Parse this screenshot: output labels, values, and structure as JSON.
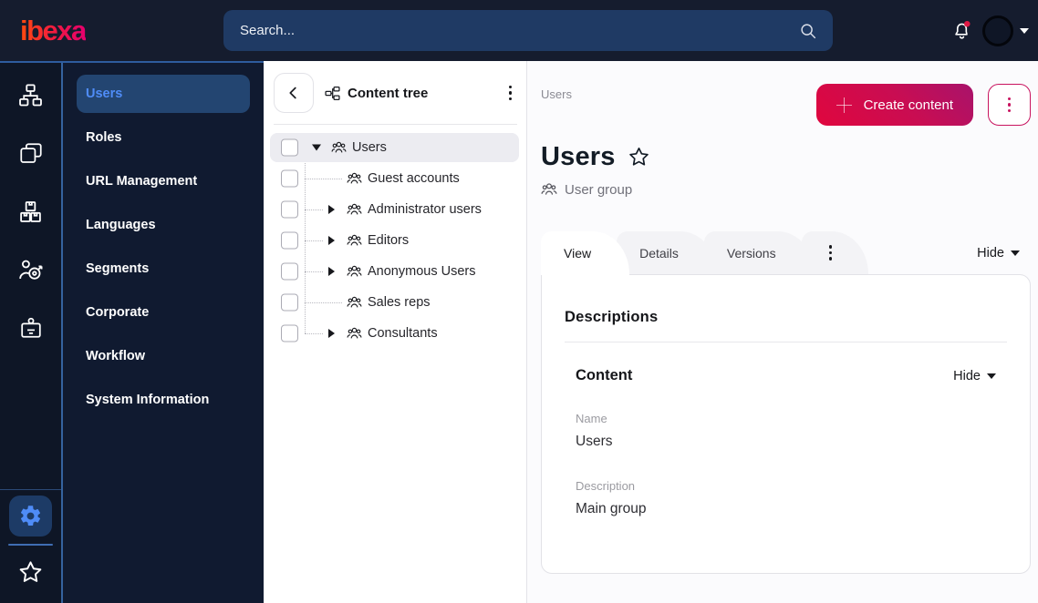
{
  "topbar": {
    "logo": "ibexa",
    "search_placeholder": "Search...",
    "icons": [
      "search-icon",
      "bell-icon",
      "avatar",
      "caret-down-icon"
    ]
  },
  "icon_sidebar": {
    "items": [
      "content-structure-icon",
      "pages-icon",
      "product-catalog-icon",
      "personalization-icon",
      "admin-badge-icon"
    ],
    "bottom": [
      "settings-gear-icon",
      "bookmarks-star-icon"
    ]
  },
  "menu": {
    "items": [
      {
        "label": "Users",
        "selected": true
      },
      {
        "label": "Roles",
        "selected": false
      },
      {
        "label": "URL Management",
        "selected": false
      },
      {
        "label": "Languages",
        "selected": false
      },
      {
        "label": "Segments",
        "selected": false
      },
      {
        "label": "Corporate",
        "selected": false
      },
      {
        "label": "Workflow",
        "selected": false
      },
      {
        "label": "System Information",
        "selected": false
      }
    ]
  },
  "tree": {
    "title": "Content tree",
    "rows": [
      {
        "label": "Users",
        "state": "expanded",
        "selected": true,
        "level": 0
      },
      {
        "label": "Guest accounts",
        "state": "leaf",
        "selected": false,
        "level": 1
      },
      {
        "label": "Administrator users",
        "state": "collapsed",
        "selected": false,
        "level": 1
      },
      {
        "label": "Editors",
        "state": "collapsed",
        "selected": false,
        "level": 1
      },
      {
        "label": "Anonymous Users",
        "state": "collapsed",
        "selected": false,
        "level": 1
      },
      {
        "label": "Sales reps",
        "state": "leaf",
        "selected": false,
        "level": 1
      },
      {
        "label": "Consultants",
        "state": "collapsed",
        "selected": false,
        "level": 1
      }
    ]
  },
  "main": {
    "breadcrumb": "Users",
    "create_button": "Create content",
    "title": "Users",
    "content_type": "User group",
    "tabs": [
      {
        "label": "View",
        "active": true
      },
      {
        "label": "Details",
        "active": false
      },
      {
        "label": "Versions",
        "active": false
      }
    ],
    "hide_label": "Hide",
    "card": {
      "section_title": "Descriptions",
      "subsection_title": "Content",
      "hide_label": "Hide",
      "fields": [
        {
          "label": "Name",
          "value": "Users"
        },
        {
          "label": "Description",
          "value": "Main group"
        }
      ]
    }
  },
  "colors": {
    "topbar_bg": "#151c2e",
    "iconbar_bg": "#0e1626",
    "menubar_bg": "#101a30",
    "accent_blue": "#4f8cf7",
    "divider_blue": "#35639f",
    "primary_red": "#e0063e",
    "primary_gradient_end": "#a8136b",
    "selected_pill": "#234571",
    "tree_selected_bg": "#ececf1"
  }
}
